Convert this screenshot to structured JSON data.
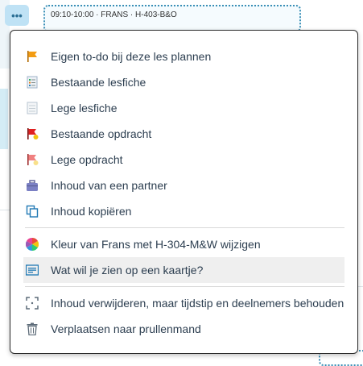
{
  "lesson_card": {
    "header": "09:10-10:00 · FRANS · H-403-B&O"
  },
  "menu": {
    "items": [
      {
        "label": "Eigen to-do bij deze les plannen",
        "icon": "orange-flag-icon"
      },
      {
        "label": "Bestaande lesfiche",
        "icon": "lesson-sheet-icon"
      },
      {
        "label": "Lege lesfiche",
        "icon": "empty-lesson-sheet-icon"
      },
      {
        "label": "Bestaande opdracht",
        "icon": "red-flag-icon"
      },
      {
        "label": "Lege opdracht",
        "icon": "empty-assignment-flag-icon"
      },
      {
        "label": "Inhoud van een partner",
        "icon": "briefcase-icon"
      },
      {
        "label": "Inhoud kopiëren",
        "icon": "copy-icon"
      },
      {
        "label": "Kleur van Frans met H-304-M&W wijzigen",
        "icon": "color-wheel-icon"
      },
      {
        "label": "Wat wil je zien op een kaartje?",
        "icon": "card-view-icon"
      },
      {
        "label": "Inhoud verwijderen, maar tijdstip en deelnemers behouden",
        "icon": "clear-content-icon"
      },
      {
        "label": "Verplaatsen naar prullenmand",
        "icon": "trash-icon"
      }
    ]
  },
  "colors": {
    "accent": "#3a8fb6",
    "menu_border": "#2b2b2b",
    "highlight": "#efefef",
    "text": "#2c3e50"
  }
}
